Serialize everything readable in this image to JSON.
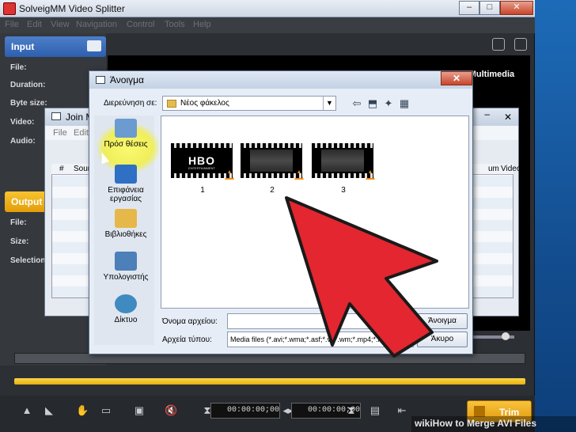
{
  "app": {
    "title": "SolveigMM Video Splitter",
    "menu": [
      "File",
      "Edit",
      "View",
      "Navigation",
      "Control",
      "Tools",
      "Help"
    ],
    "window_buttons": [
      "–",
      "□",
      "✕"
    ],
    "brand": "gMultimedia"
  },
  "input_panel": {
    "header": "Input",
    "fields": [
      "File:",
      "Duration:",
      "Byte size:",
      "Video:",
      "Audio:"
    ]
  },
  "output_panel": {
    "header": "Output",
    "fields": [
      "File:",
      "Size:",
      "Selection:"
    ]
  },
  "join_window": {
    "title": "Join M",
    "menu": [
      "File",
      "Edit"
    ],
    "columns": [
      "#",
      "Sour",
      "um",
      "Video"
    ],
    "buttons": [
      "–",
      "✕"
    ]
  },
  "dialog": {
    "title": "Άνοιγμα",
    "close": "✕",
    "look_in_label": "Διερεύνηση σε:",
    "look_in_value": "Νέος φάκελος",
    "places": [
      {
        "label": "Πρόσ θέσεις",
        "icon": "recent-places-icon",
        "color": "#6b9bd1"
      },
      {
        "label": "Επιφάνεια εργασίας",
        "icon": "desktop-icon",
        "color": "#2f6fc4"
      },
      {
        "label": "Βιβλιοθήκες",
        "icon": "libraries-icon",
        "color": "#e6b84a"
      },
      {
        "label": "Υπολογιστής",
        "icon": "computer-icon",
        "color": "#4d7fb8"
      },
      {
        "label": "Δίκτυο",
        "icon": "network-icon",
        "color": "#3f8ac0"
      }
    ],
    "files": [
      {
        "name": "1",
        "thumb_text": "HBO",
        "thumb_sub": "ENTERTAINMENT"
      },
      {
        "name": "2"
      },
      {
        "name": "3"
      }
    ],
    "filename_label": "Όνομα αρχείου:",
    "filename_value": "",
    "filetype_label": "Αρχεία τύπου:",
    "filetype_value": "Media files (*.avi;*.wma;*.asf;*.v   ;*.wm;*.mp4;*.mo",
    "open_button": "Άνοιγμα",
    "cancel_button": "Άκυρο"
  },
  "toolbar": {
    "time_start": "00:00:00;00",
    "time_end": "00:00:00;00",
    "trim_label": "Trim"
  },
  "watermark": "wikiHow to Merge AVI Files"
}
